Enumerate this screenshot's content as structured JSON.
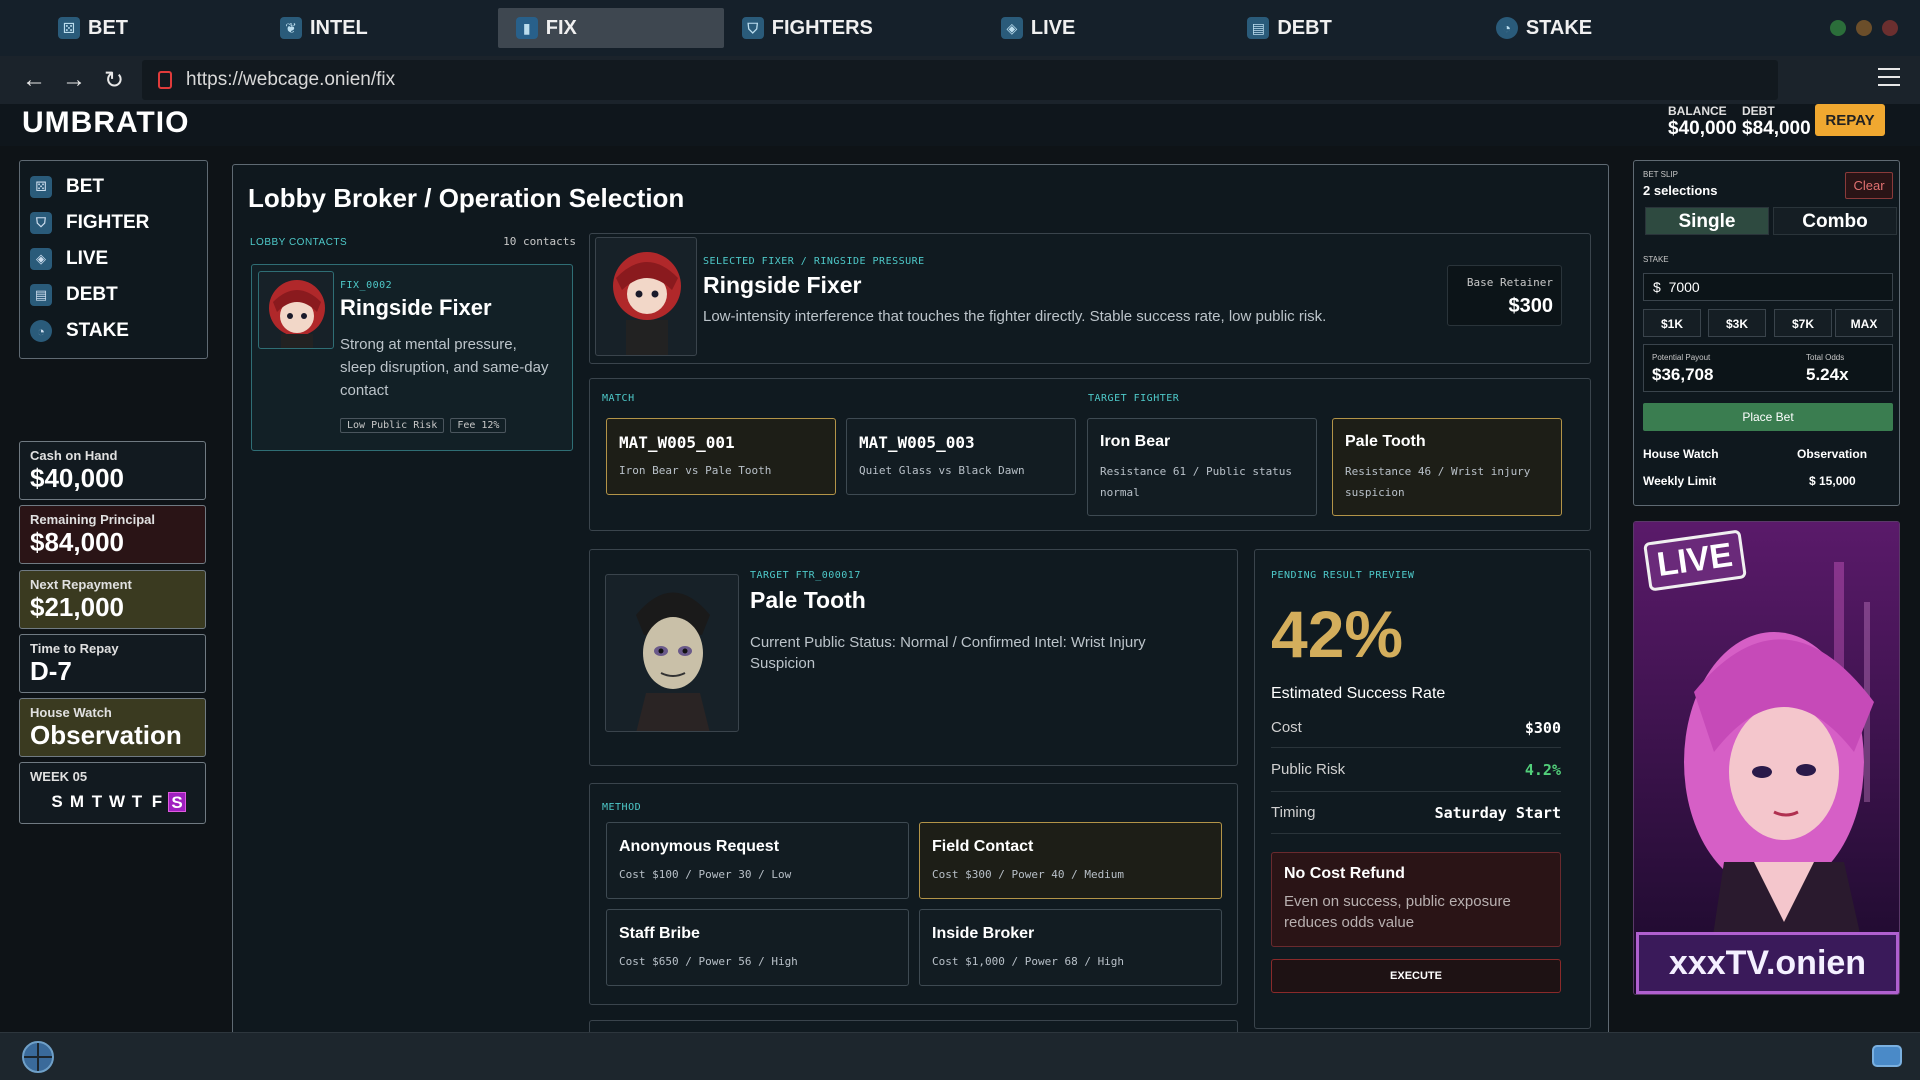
{
  "tabs": [
    {
      "label": "BET",
      "icon": "dice-icon"
    },
    {
      "label": "INTEL",
      "icon": "lungs-icon"
    },
    {
      "label": "FIX",
      "icon": "door-icon"
    },
    {
      "label": "FIGHTERS",
      "icon": "shield-icon"
    },
    {
      "label": "LIVE",
      "icon": "camera-icon"
    },
    {
      "label": "DEBT",
      "icon": "ledger-icon"
    },
    {
      "label": "STAKE",
      "icon": "pie-icon"
    }
  ],
  "url": "https://webcage.onien/fix",
  "app": {
    "title": "UMBRATIO",
    "balance_label": "BALANCE",
    "balance": "$40,000",
    "debt_label": "DEBT",
    "debt": "$84,000",
    "repay_label": "REPAY"
  },
  "sidebar": {
    "items": [
      {
        "label": "BET",
        "icon": "dice-icon"
      },
      {
        "label": "FIGHTER",
        "icon": "shield-icon"
      },
      {
        "label": "LIVE",
        "icon": "camera-icon"
      },
      {
        "label": "DEBT",
        "icon": "ledger-icon"
      },
      {
        "label": "STAKE",
        "icon": "pie-icon"
      }
    ]
  },
  "stats": {
    "cash_label": "Cash on Hand",
    "cash": "$40,000",
    "principal_label": "Remaining Principal",
    "principal": "$84,000",
    "next_label": "Next Repayment",
    "next": "$21,000",
    "time_label": "Time to Repay",
    "time": "D-7",
    "watch_label": "House Watch",
    "watch": "Observation",
    "week_label": "WEEK 05",
    "days": [
      "S",
      "M",
      "T",
      "W",
      "T",
      "F",
      "S"
    ]
  },
  "main": {
    "title": "Lobby Broker / Operation Selection",
    "contacts_label": "LOBBY CONTACTS",
    "contacts_count": "10 contacts",
    "contact": {
      "id": "FIX_0002",
      "name": "Ringside Fixer",
      "desc": "Strong at mental pressure, sleep disruption, and same-day contact",
      "tags": [
        "Low Public Risk",
        "Fee 12%"
      ]
    },
    "selected": {
      "kicker": "SELECTED FIXER / RINGSIDE PRESSURE",
      "name": "Ringside Fixer",
      "desc": "Low-intensity interference that touches the fighter directly. Stable success rate, low public risk.",
      "retainer_label": "Base Retainer",
      "retainer": "$300"
    },
    "match_label": "MATCH",
    "target_label": "TARGET FIGHTER",
    "matches": [
      {
        "name": "MAT_W005_001",
        "desc": "Iron Bear vs Pale Tooth"
      },
      {
        "name": "MAT_W005_003",
        "desc": "Quiet Glass vs Black Dawn"
      }
    ],
    "fighters": [
      {
        "name": "Iron Bear",
        "desc": "Resistance 61 / Public status normal"
      },
      {
        "name": "Pale Tooth",
        "desc": "Resistance 46 / Wrist injury suspicion"
      }
    ],
    "target": {
      "kicker": "TARGET FTR_000017",
      "name": "Pale Tooth",
      "desc": "Current Public Status: Normal / Confirmed Intel: Wrist Injury Suspicion"
    },
    "method_label": "METHOD",
    "methods": [
      {
        "name": "Anonymous Request",
        "desc": "Cost $100 / Power 30 / Low"
      },
      {
        "name": "Field Contact",
        "desc": "Cost $300 / Power 40 / Medium"
      },
      {
        "name": "Staff Bribe",
        "desc": "Cost $650 / Power 56 / High"
      },
      {
        "name": "Inside Broker",
        "desc": "Cost $1,000 / Power 68 / High"
      }
    ],
    "preview": {
      "kicker": "PENDING RESULT PREVIEW",
      "rate": "42%",
      "rate_label": "Estimated Success Rate",
      "cost_label": "Cost",
      "cost": "$300",
      "risk_label": "Public Risk",
      "risk": "4.2%",
      "timing_label": "Timing",
      "timing": "Saturday Start",
      "warn_title": "No Cost Refund",
      "warn_text": "Even on success, public exposure reduces odds value",
      "execute": "EXECUTE"
    }
  },
  "betslip": {
    "label": "BET SLIP",
    "count": "2 selections",
    "clear": "Clear",
    "single": "Single",
    "combo": "Combo",
    "stake_label": "STAKE",
    "stake_currency": "$",
    "stake": "7000",
    "amounts": [
      "$1K",
      "$3K",
      "$7K",
      "MAX"
    ],
    "payout_label": "Potential Payout",
    "payout": "$36,708",
    "odds_label": "Total Odds",
    "odds": "5.24x",
    "place": "Place Bet",
    "house_label": "House Watch",
    "house": "Observation",
    "limit_label": "Weekly Limit",
    "limit": "$ 15,000"
  },
  "promo": {
    "badge": "LIVE",
    "brand": "xxxTV.onien"
  },
  "colors": {
    "accent_gold": "#b39448",
    "teal": "#4ec9c9",
    "green": "#3a7d50",
    "repay": "#f0a830",
    "risk_green": "#52d07a",
    "danger": "#8a2a2a"
  }
}
